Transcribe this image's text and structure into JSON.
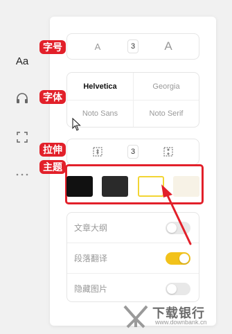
{
  "rail": {
    "font_icon": "Aa"
  },
  "labels": {
    "font_size": "字号",
    "font_face": "字体",
    "stretch": "拉伸",
    "theme": "主题"
  },
  "font_size": {
    "small": "A",
    "value": "3",
    "large": "A"
  },
  "font_faces": [
    {
      "name": "Helvetica",
      "selected": true
    },
    {
      "name": "Georgia",
      "selected": false
    },
    {
      "name": "Noto Sans",
      "selected": false
    },
    {
      "name": "Noto Serif",
      "selected": false
    }
  ],
  "stretch": {
    "value": "3"
  },
  "themes": [
    {
      "name": "black",
      "color": "#111111"
    },
    {
      "name": "dark-gray",
      "color": "#2a2a2a"
    },
    {
      "name": "white",
      "color": "#ffffff",
      "border": "#f2d533"
    },
    {
      "name": "beige",
      "color": "#f7f2e6"
    }
  ],
  "toggles": [
    {
      "label": "文章大纲",
      "on": false
    },
    {
      "label": "段落翻译",
      "on": true
    },
    {
      "label": "隐藏图片",
      "on": false
    }
  ],
  "watermark": {
    "title": "下载银行",
    "url": "www.downbank.cn"
  },
  "colors": {
    "highlight": "#e2202a",
    "toggle_on": "#f2c21b"
  }
}
